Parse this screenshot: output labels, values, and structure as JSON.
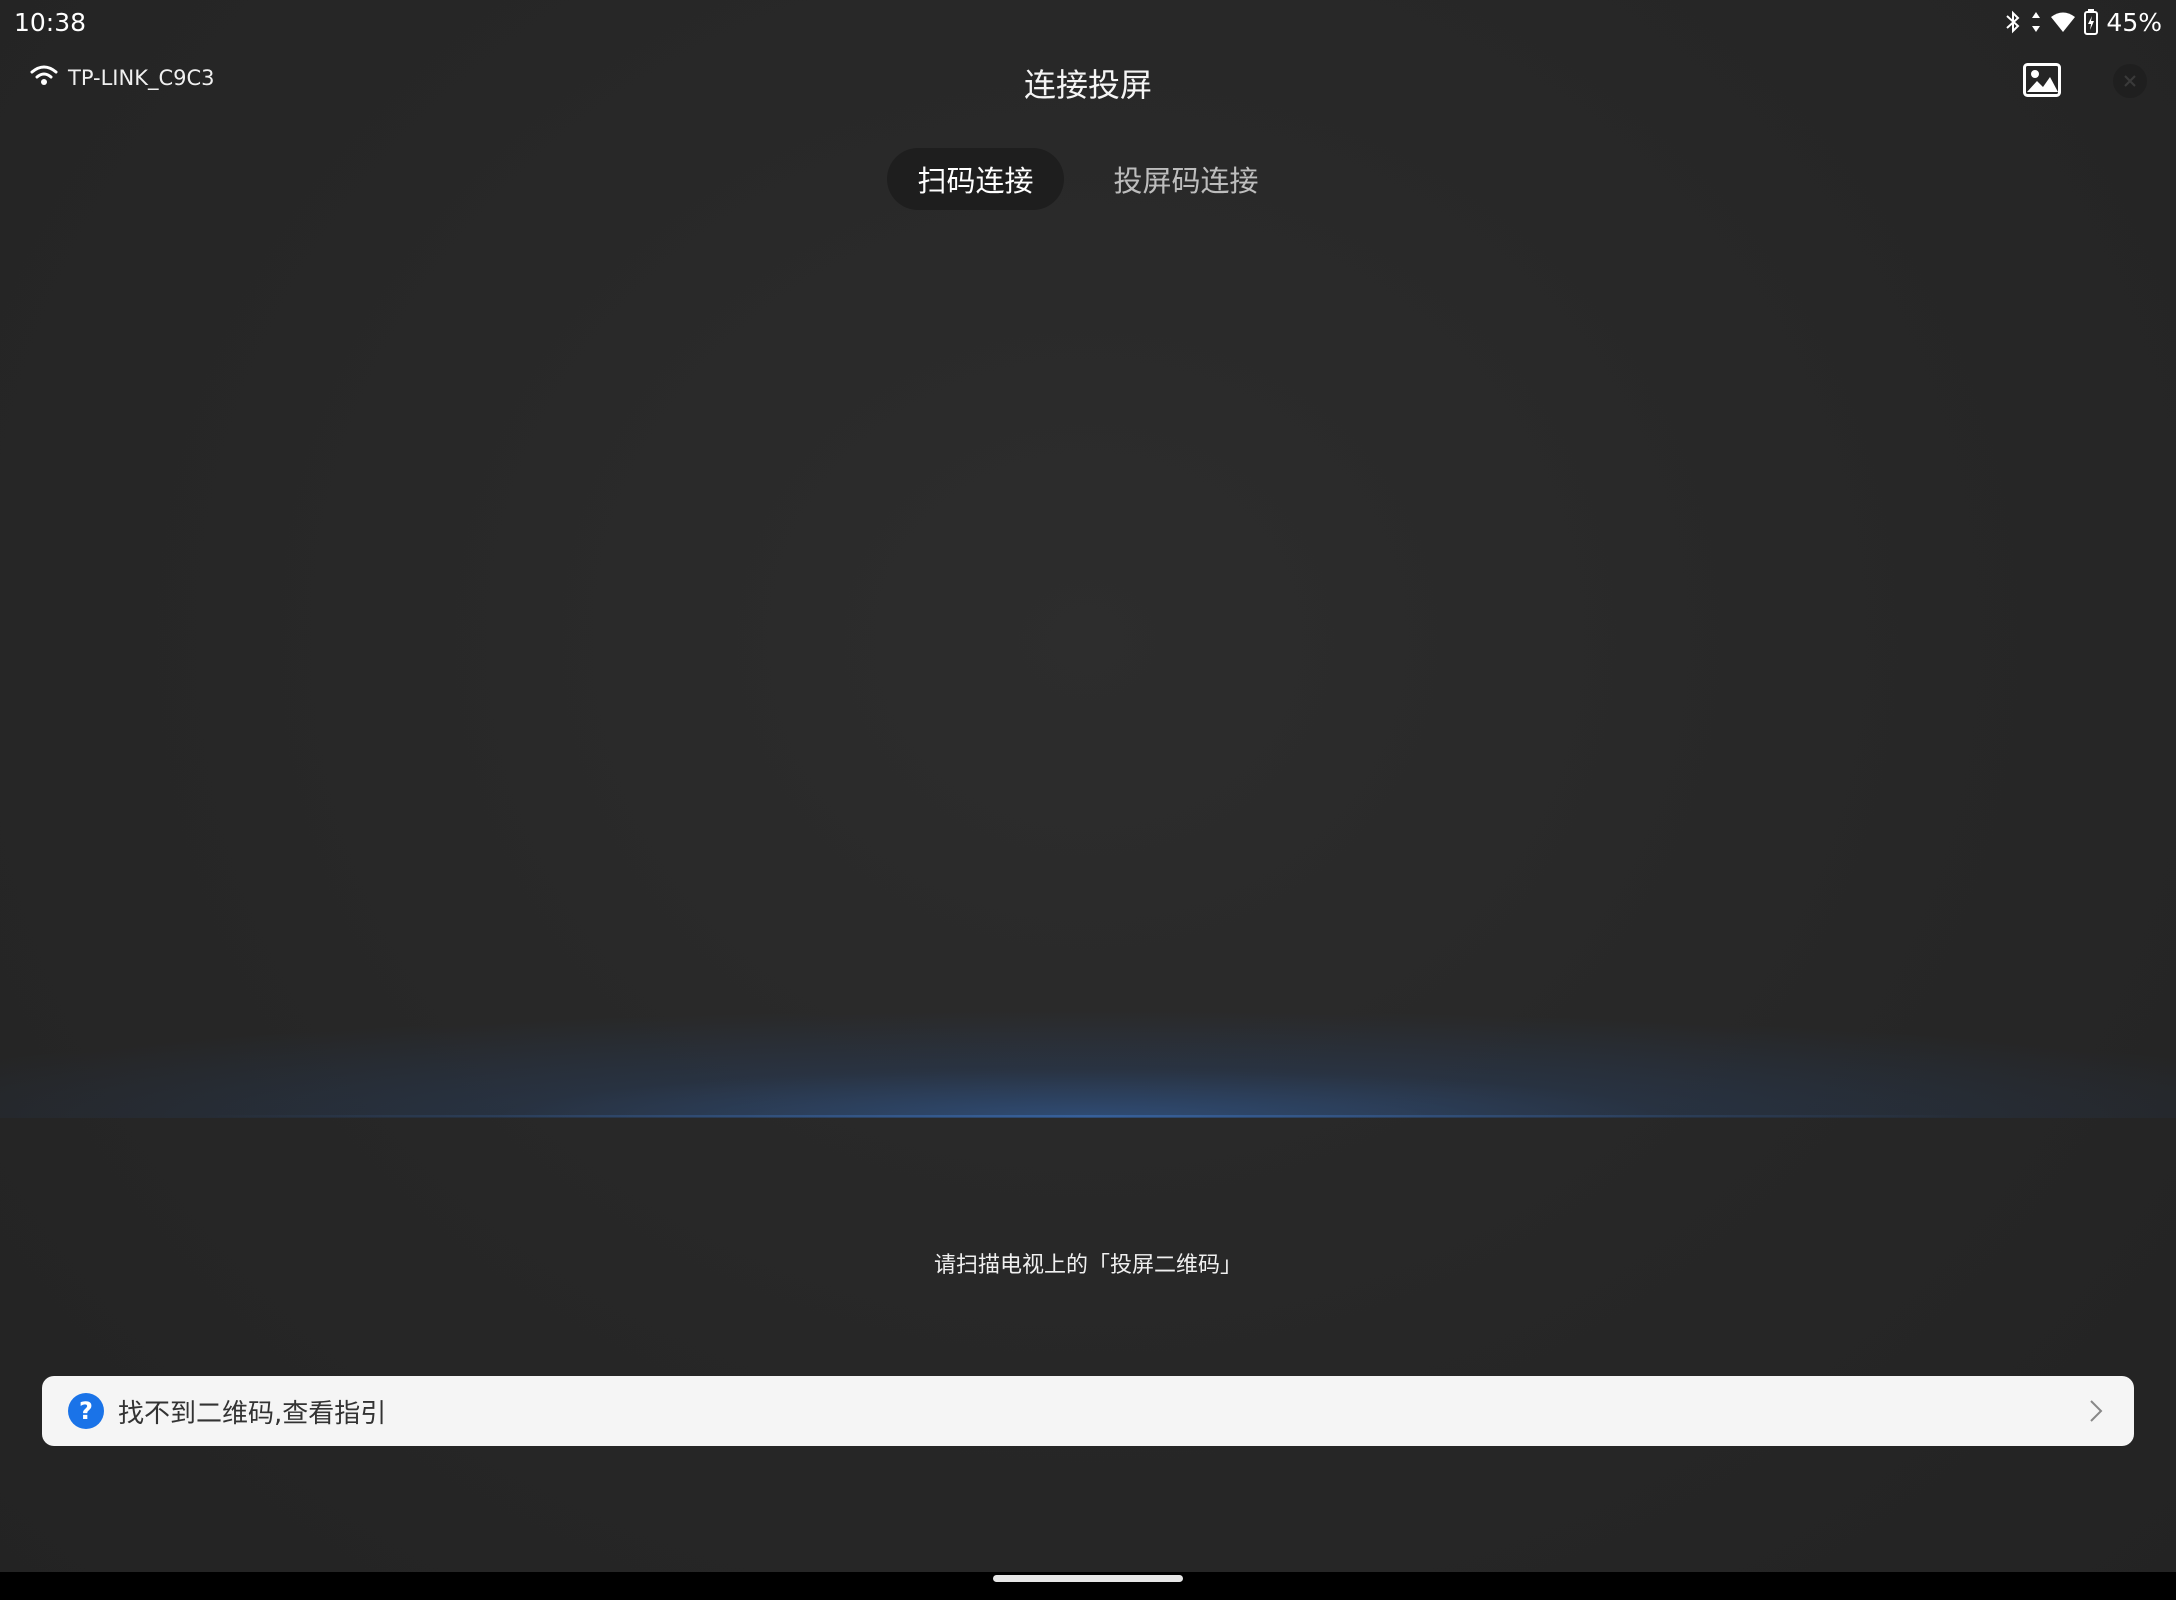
{
  "status_bar": {
    "time": "10:38",
    "battery": "45%",
    "icons": [
      "bluetooth-icon",
      "data-arrows-icon",
      "wifi-icon",
      "battery-icon"
    ]
  },
  "header": {
    "wifi_name": "TP-LINK_C9C3",
    "title": "连接投屏",
    "gallery_icon": "image-icon",
    "close_icon": "close-icon"
  },
  "tabs": [
    {
      "label": "扫码连接",
      "active": true
    },
    {
      "label": "投屏码连接",
      "active": false
    }
  ],
  "scanner": {
    "hint": "请扫描电视上的「投屏二维码」"
  },
  "guide": {
    "label": "找不到二维码,查看指引",
    "icon": "help-icon"
  },
  "colors": {
    "accent": "#1a73e8",
    "background": "#262626"
  }
}
